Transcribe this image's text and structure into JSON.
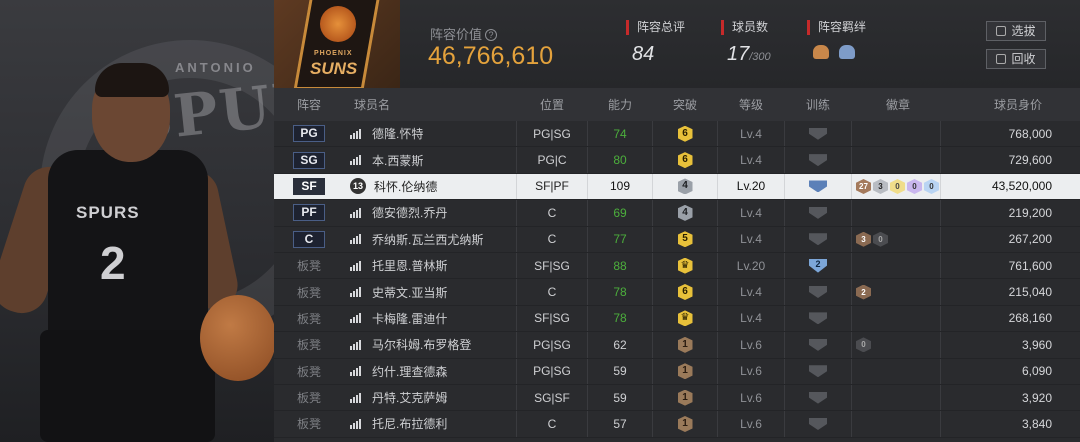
{
  "hero": {
    "team_text": "ANTONIO",
    "team_word": "SPURS",
    "jersey_name": "SPURS",
    "jersey_number": "2"
  },
  "team_logo": {
    "line1": "PHOENIX",
    "line2": "SUNS"
  },
  "header": {
    "value_label": "阵容价值",
    "value": "46,766,610",
    "rating_label": "阵容总评",
    "rating": "84",
    "count_label": "球员数",
    "count": "17",
    "count_max": "/300",
    "bond_label": "阵容羁绊",
    "select_button": "选拔",
    "recycle_button": "回收"
  },
  "columns": {
    "lineup": "阵容",
    "name": "球员名",
    "position": "位置",
    "ability": "能力",
    "breakthrough": "突破",
    "level": "等级",
    "training": "训练",
    "badges": "徽章",
    "price": "球员身价"
  },
  "colors": {
    "gold_value": "#e4a23c",
    "accent_red": "#c62a2a",
    "ability_green": "#4caf3c",
    "selected_row": "#eceef0"
  },
  "rows": [
    {
      "slot": "PG",
      "starter": true,
      "name": "德隆.怀特",
      "position": "PG|SG",
      "ability": "74",
      "ability_color": "green",
      "break": "6",
      "break_tier": "gold",
      "level": "Lv.4",
      "training": "",
      "badges": [],
      "price": "768,000"
    },
    {
      "slot": "SG",
      "starter": true,
      "name": "本.西蒙斯",
      "position": "PG|C",
      "ability": "80",
      "ability_color": "green",
      "break": "6",
      "break_tier": "gold",
      "level": "Lv.4",
      "training": "",
      "badges": [],
      "price": "729,600"
    },
    {
      "slot": "SF",
      "starter": true,
      "selected": true,
      "number": "13",
      "name": "科怀.伦纳德",
      "position": "SF|PF",
      "ability": "109",
      "ability_color": "",
      "break": "4",
      "break_tier": "silver",
      "level": "Lv.20",
      "training": "",
      "badges": [
        "27",
        "3",
        "0",
        "0",
        "0"
      ],
      "price": "43,520,000"
    },
    {
      "slot": "PF",
      "starter": true,
      "name": "德安德烈.乔丹",
      "position": "C",
      "ability": "69",
      "ability_color": "green",
      "break": "4",
      "break_tier": "silver",
      "level": "Lv.4",
      "training": "",
      "badges": [],
      "price": "219,200"
    },
    {
      "slot": "C",
      "starter": true,
      "name": "乔纳斯.瓦兰西尤纳斯",
      "position": "C",
      "ability": "77",
      "ability_color": "green",
      "break": "5",
      "break_tier": "gold",
      "level": "Lv.4",
      "training": "",
      "badges": [
        "3",
        "0"
      ],
      "price": "267,200"
    },
    {
      "slot": "板凳",
      "starter": false,
      "name": "托里恩.普林斯",
      "position": "SF|SG",
      "ability": "88",
      "ability_color": "green",
      "break": "♛",
      "break_tier": "crown",
      "level": "Lv.20",
      "training": "2",
      "badges": [],
      "price": "761,600"
    },
    {
      "slot": "板凳",
      "starter": false,
      "name": "史蒂文.亚当斯",
      "position": "C",
      "ability": "78",
      "ability_color": "green",
      "break": "6",
      "break_tier": "gold",
      "level": "Lv.4",
      "training": "",
      "badges": [
        "2"
      ],
      "price": "215,040"
    },
    {
      "slot": "板凳",
      "starter": false,
      "name": "卡梅隆.雷迪什",
      "position": "SF|SG",
      "ability": "78",
      "ability_color": "green",
      "break": "♛",
      "break_tier": "crown",
      "level": "Lv.4",
      "training": "",
      "badges": [],
      "price": "268,160"
    },
    {
      "slot": "板凳",
      "starter": false,
      "name": "马尔科姆.布罗格登",
      "position": "PG|SG",
      "ability": "62",
      "ability_color": "",
      "break": "1",
      "break_tier": "bronze",
      "level": "Lv.6",
      "training": "",
      "badges": [
        "0"
      ],
      "price": "3,960"
    },
    {
      "slot": "板凳",
      "starter": false,
      "name": "约什.理查德森",
      "position": "PG|SG",
      "ability": "59",
      "ability_color": "",
      "break": "1",
      "break_tier": "bronze",
      "level": "Lv.6",
      "training": "",
      "badges": [],
      "price": "6,090"
    },
    {
      "slot": "板凳",
      "starter": false,
      "name": "丹特.艾克萨姆",
      "position": "SG|SF",
      "ability": "59",
      "ability_color": "",
      "break": "1",
      "break_tier": "bronze",
      "level": "Lv.6",
      "training": "",
      "badges": [],
      "price": "3,920"
    },
    {
      "slot": "板凳",
      "starter": false,
      "name": "托尼.布拉德利",
      "position": "C",
      "ability": "57",
      "ability_color": "",
      "break": "1",
      "break_tier": "bronze",
      "level": "Lv.6",
      "training": "",
      "badges": [],
      "price": "3,840"
    }
  ]
}
